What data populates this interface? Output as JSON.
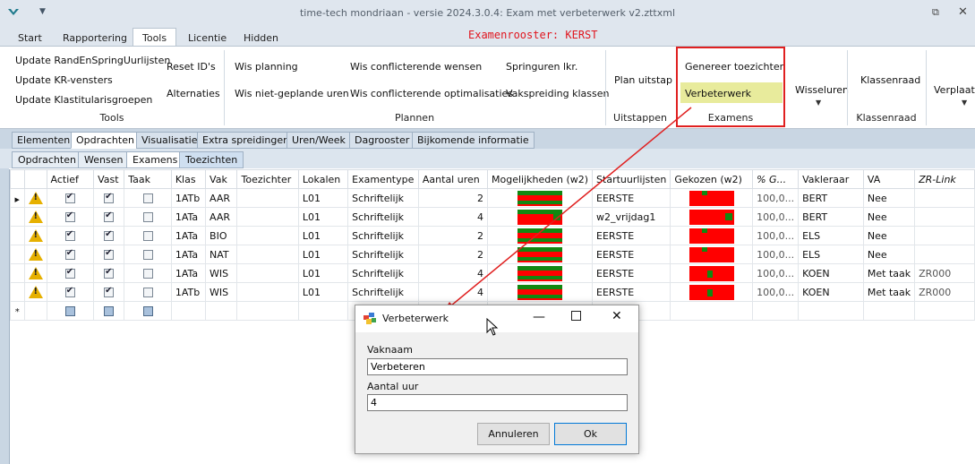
{
  "window": {
    "title": "time-tech mondriaan - versie 2024.3.0.4: Exam met verbeterwerk v2.zttxml"
  },
  "ribbon_tabs": [
    "Start",
    "Rapportering",
    "Tools",
    "Licentie",
    "Hidden"
  ],
  "exam_title": "Examenrooster: KERST",
  "ribbon": {
    "tools": {
      "items": [
        "Update RandEnSpringUurlijsten",
        "Update KR-vensters",
        "Update Klastitularisgroepen",
        "Reset ID's",
        "Alternaties"
      ],
      "label": "Tools"
    },
    "plannen": {
      "items": [
        "Wis planning",
        "Wis niet-geplande uren",
        "Wis conflicterende wensen",
        "Wis conflicterende optimalisaties",
        "Springuren lkr.",
        "Vakspreiding klassen"
      ],
      "label": "Plannen"
    },
    "uitstappen": {
      "items": [
        "Plan uitstap"
      ],
      "label": "Uitstappen"
    },
    "examens": {
      "items": [
        "Genereer toezichten",
        "Verbeterwerk"
      ],
      "label": "Examens"
    },
    "wisseluren": "Wisseluren",
    "klassenraad": {
      "item": "Klassenraad",
      "label": "Klassenraad"
    },
    "verplaats": "Verplaats"
  },
  "tabs_level2": [
    "Elementen",
    "Opdrachten",
    "Visualisatie",
    "Extra spreidingen",
    "Uren/Week",
    "Dagrooster",
    "Bijkomende informatie"
  ],
  "tabs_level3": [
    "Opdrachten",
    "Wensen",
    "Examens",
    "Toezichten"
  ],
  "grid": {
    "columns": [
      "Actief",
      "Vast",
      "Taak",
      "Klas",
      "Vak",
      "Toezichter",
      "Lokalen",
      "Examentype",
      "Aantal uren",
      "Mogelijkheden (w2)",
      "Startuurlijsten",
      "Gekozen (w2)",
      "% G...",
      "Vakleraar",
      "VA",
      "ZR-Link"
    ],
    "rows": [
      {
        "actief": true,
        "vast": true,
        "taak": false,
        "klas": "1ATb",
        "vak": "AAR",
        "toezichter": "",
        "lokalen": "L01",
        "examentype": "Schriftelijk",
        "uren": "2",
        "start": "EERSTE",
        "pct": "100,0...",
        "vakleraar": "BERT",
        "va": "Nee",
        "zr": ""
      },
      {
        "actief": true,
        "vast": true,
        "taak": false,
        "klas": "1ATa",
        "vak": "AAR",
        "toezichter": "",
        "lokalen": "L01",
        "examentype": "Schriftelijk",
        "uren": "4",
        "start": "w2_vrijdag1",
        "pct": "100,0...",
        "vakleraar": "BERT",
        "va": "Nee",
        "zr": ""
      },
      {
        "actief": true,
        "vast": true,
        "taak": false,
        "klas": "1ATa",
        "vak": "BIO",
        "toezichter": "",
        "lokalen": "L01",
        "examentype": "Schriftelijk",
        "uren": "2",
        "start": "EERSTE",
        "pct": "100,0...",
        "vakleraar": "ELS",
        "va": "Nee",
        "zr": ""
      },
      {
        "actief": true,
        "vast": true,
        "taak": false,
        "klas": "1ATa",
        "vak": "NAT",
        "toezichter": "",
        "lokalen": "L01",
        "examentype": "Schriftelijk",
        "uren": "2",
        "start": "EERSTE",
        "pct": "100,0...",
        "vakleraar": "ELS",
        "va": "Nee",
        "zr": ""
      },
      {
        "actief": true,
        "vast": true,
        "taak": false,
        "klas": "1ATa",
        "vak": "WIS",
        "toezichter": "",
        "lokalen": "L01",
        "examentype": "Schriftelijk",
        "uren": "4",
        "start": "EERSTE",
        "pct": "100,0...",
        "vakleraar": "KOEN",
        "va": "Met taak",
        "zr": "ZR000"
      },
      {
        "actief": true,
        "vast": true,
        "taak": false,
        "klas": "1ATb",
        "vak": "WIS",
        "toezichter": "",
        "lokalen": "L01",
        "examentype": "Schriftelijk",
        "uren": "4",
        "start": "EERSTE",
        "pct": "100,0...",
        "vakleraar": "KOEN",
        "va": "Met taak",
        "zr": "ZR000"
      }
    ]
  },
  "dialog": {
    "title": "Verbeterwerk",
    "vaknaam_label": "Vaknaam",
    "vaknaam_value": "Verbeteren",
    "uur_label": "Aantal uur",
    "uur_value": "4",
    "cancel": "Annuleren",
    "ok": "Ok"
  },
  "colors": {
    "highlight": "#e02020",
    "chart_red": "#ff0000",
    "chart_green": "#118811"
  }
}
